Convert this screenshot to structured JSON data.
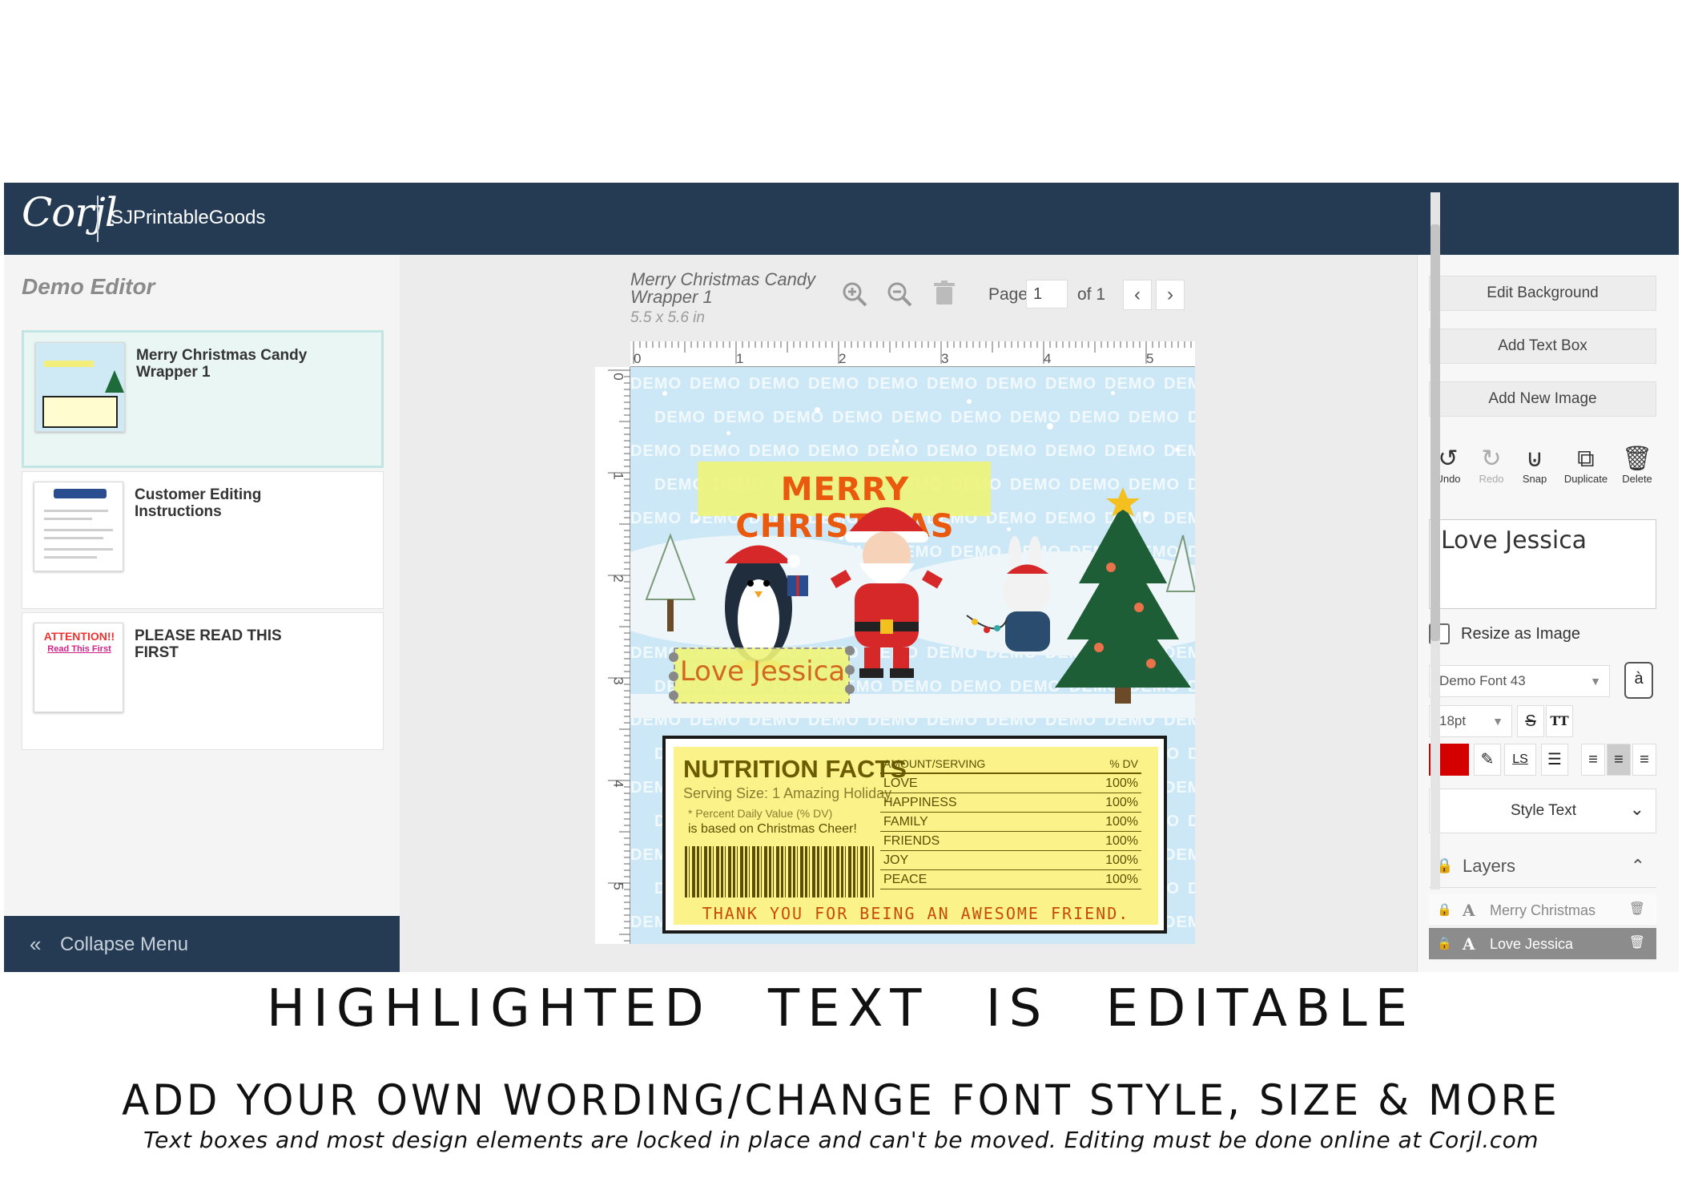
{
  "app": {
    "logo": "Corjl",
    "store": "SJPrintableGoods"
  },
  "left_panel": {
    "title": "Demo Editor",
    "pages": [
      {
        "name": "Merry Christmas Candy Wrapper 1",
        "active": true
      },
      {
        "name": "Customer Editing Instructions",
        "active": false
      },
      {
        "name": "PLEASE READ THIS FIRST",
        "active": false
      }
    ],
    "thumb3": {
      "attention": "ATTENTION!!",
      "read_first": "Read This First"
    },
    "collapse_label": "Collapse Menu"
  },
  "center": {
    "doc_title": "Merry Christmas Candy Wrapper 1",
    "doc_size": "5.5 x 5.6 in",
    "page_label": "Page",
    "page_value": "1",
    "page_of": "of 1",
    "ruler_h": [
      "0",
      "1",
      "2",
      "3",
      "4",
      "5"
    ],
    "ruler_v": [
      "0",
      "1",
      "2",
      "3",
      "4",
      "5"
    ],
    "watermark": "DEMO",
    "design": {
      "merry_christmas": "MERRY CHRISTMAS",
      "love_text": "Love Jessica",
      "nutrition": {
        "title": "NUTRITION FACTS",
        "serving": "Serving Size: 1 Amazing Holiday",
        "percent_note": "* Percent Daily Value (% DV)",
        "based_on": "is based on Christmas Cheer!",
        "header": {
          "k": "AMOUNT/SERVING",
          "v": "% DV"
        },
        "rows": [
          {
            "k": "LOVE",
            "v": "100%"
          },
          {
            "k": "HAPPINESS",
            "v": "100%"
          },
          {
            "k": "FAMILY",
            "v": "100%"
          },
          {
            "k": "FRIENDS",
            "v": "100%"
          },
          {
            "k": "JOY",
            "v": "100%"
          },
          {
            "k": "PEACE",
            "v": "100%"
          }
        ],
        "thanks": "THANK YOU FOR BEING AN AWESOME FRIEND."
      }
    }
  },
  "right_panel": {
    "edit_background": "Edit Background",
    "add_text_box": "Add Text Box",
    "add_new_image": "Add New Image",
    "tools": [
      {
        "label": "Undo",
        "icon": "undo-icon"
      },
      {
        "label": "Redo",
        "icon": "redo-icon"
      },
      {
        "label": "Snap",
        "icon": "magnet-icon"
      },
      {
        "label": "Duplicate",
        "icon": "duplicate-icon"
      },
      {
        "label": "Delete",
        "icon": "trash-icon"
      }
    ],
    "text_value": "Love Jessica",
    "resize_as_image": "Resize as Image",
    "font": "Demo Font 43",
    "font_size": "18pt",
    "letter_spacing_label": "LS",
    "text_color": "#d40000",
    "style_text": "Style Text",
    "layers_title": "Layers",
    "layers": [
      {
        "name": "Merry Christmas",
        "selected": false
      },
      {
        "name": "Love Jessica",
        "selected": true
      }
    ]
  },
  "captions": {
    "line1": "HIGHLIGHTED TEXT IS EDITABLE",
    "line2": "ADD YOUR OWN WORDING/CHANGE FONT STYLE, SIZE & MORE",
    "line3": "Text boxes and most design elements are locked in place and can't be moved. Editing must be done online at Corjl.com"
  }
}
